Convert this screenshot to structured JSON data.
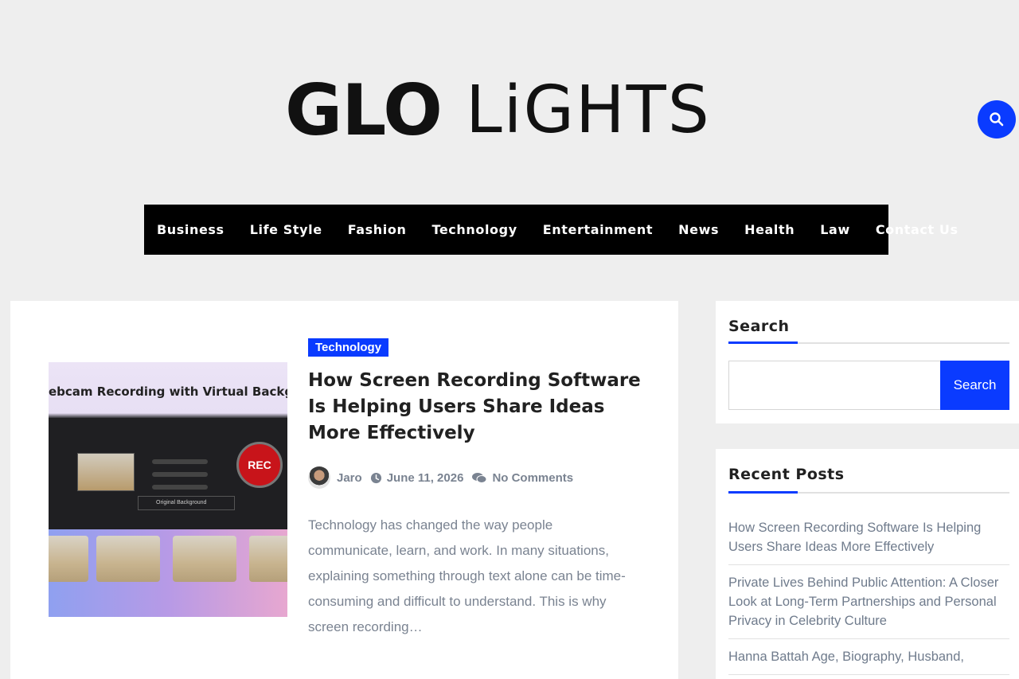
{
  "site": {
    "logo_text_1": "GLO",
    "logo_text_2": "LiGHTS"
  },
  "header": {
    "search_icon": "search-icon"
  },
  "nav": {
    "items": [
      "Business",
      "Life Style",
      "Fashion",
      "Technology",
      "Entertainment",
      "News",
      "Health",
      "Law",
      "Contact Us"
    ]
  },
  "post": {
    "category": "Technology",
    "title": "How Screen Recording Software Is Helping Users Share Ideas More Effectively",
    "thumbnail_heading": "ebcam Recording with Virtual Backgrou",
    "thumbnail_rec": "REC",
    "thumbnail_bg_label": "Original Background",
    "author": "Jaro",
    "date": "June 11, 2026",
    "comments": "No Comments",
    "excerpt": "Technology has changed the way people communicate, learn, and work. In many situations, explaining something through text alone can be time-consuming and difficult to understand. This is why screen recording…"
  },
  "sidebar": {
    "search": {
      "title": "Search",
      "placeholder": "",
      "button_label": "Search"
    },
    "recent": {
      "title": "Recent Posts",
      "items": [
        "How Screen Recording Software Is Helping Users Share Ideas More Effectively",
        "Private Lives Behind Public Attention: A Closer Look at Long-Term Partnerships and Personal Privacy in Celebrity Culture",
        "Hanna Battah Age, Biography, Husband,"
      ]
    }
  },
  "colors": {
    "accent": "#0a3bff",
    "nav_bg": "#000000",
    "page_bg": "#eeeeee"
  }
}
